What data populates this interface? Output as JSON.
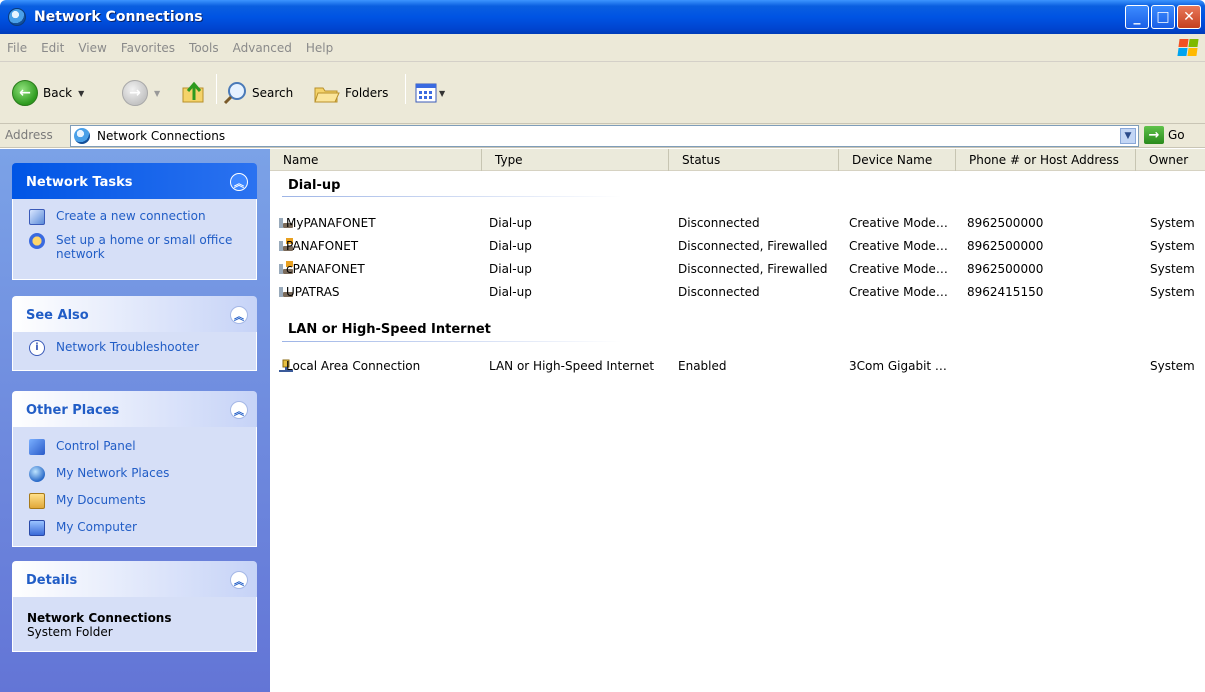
{
  "window": {
    "title": "Network Connections"
  },
  "menu": [
    "File",
    "Edit",
    "View",
    "Favorites",
    "Tools",
    "Advanced",
    "Help"
  ],
  "toolbar": {
    "back": "Back",
    "search": "Search",
    "folders": "Folders"
  },
  "address": {
    "label": "Address",
    "value": "Network Connections",
    "go": "Go"
  },
  "panels": {
    "network_tasks": {
      "title": "Network Tasks",
      "items": [
        "Create a new connection",
        "Set up a home or small office network"
      ]
    },
    "see_also": {
      "title": "See Also",
      "items": [
        "Network Troubleshooter"
      ]
    },
    "other_places": {
      "title": "Other Places",
      "items": [
        "Control Panel",
        "My Network Places",
        "My Documents",
        "My Computer"
      ]
    },
    "details": {
      "title": "Details",
      "name": "Network Connections",
      "subtitle": "System Folder"
    }
  },
  "columns": [
    "Name",
    "Type",
    "Status",
    "Device Name",
    "Phone # or Host Address",
    "Owner"
  ],
  "groups": [
    {
      "title": "Dial-up",
      "rows": [
        {
          "name": "MyPANAFONET",
          "type": "Dial-up",
          "status": "Disconnected",
          "device": "Creative Mode…",
          "phone": "8962500000",
          "owner": "System"
        },
        {
          "name": "PANAFONET",
          "type": "Dial-up",
          "status": "Disconnected, Firewalled",
          "device": "Creative Mode…",
          "phone": "8962500000",
          "owner": "System"
        },
        {
          "name": "cPANAFONET",
          "type": "Dial-up",
          "status": "Disconnected, Firewalled",
          "device": "Creative Mode…",
          "phone": "8962500000",
          "owner": "System"
        },
        {
          "name": "UPATRAS",
          "type": "Dial-up",
          "status": "Disconnected",
          "device": "Creative Mode…",
          "phone": "8962415150",
          "owner": "System"
        }
      ]
    },
    {
      "title": "LAN or High-Speed Internet",
      "rows": [
        {
          "name": "Local Area Connection",
          "type": "LAN or High-Speed Internet",
          "status": "Enabled",
          "device": "3Com Gigabit …",
          "phone": "",
          "owner": "System"
        }
      ]
    }
  ]
}
